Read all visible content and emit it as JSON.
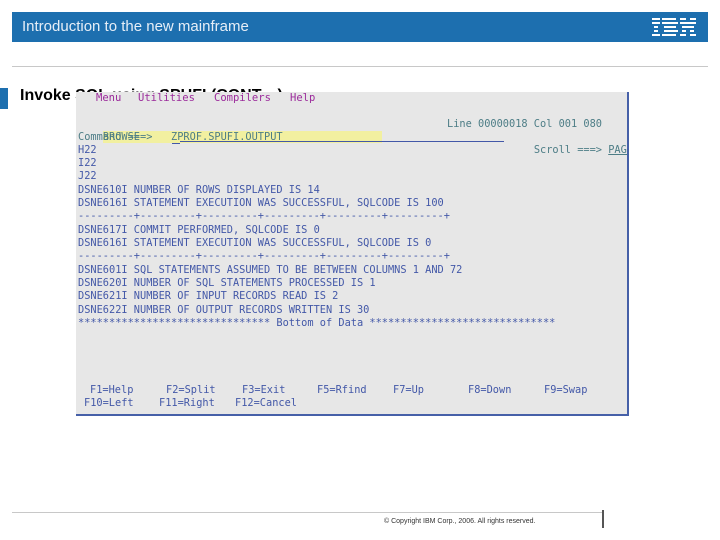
{
  "header": {
    "title": "Introduction to the new mainframe",
    "logo_text": "IBM",
    "brand_color": "#1d6faf"
  },
  "slide": {
    "title": "Invoke SQL using SPUFI (CONT…)"
  },
  "terminal": {
    "menu": [
      "Menu",
      "Utilities",
      "Compilers",
      "Help"
    ],
    "browse_label": "BROWSE",
    "dataset": "ZPROF.SPUFI.OUTPUT",
    "line_info": "Line 00000018 Col 001 080",
    "command_label": "Command ===>",
    "command_value": "",
    "scroll_label": "Scroll ===>",
    "scroll_value": "PAGE",
    "lines": [
      "H22",
      "I22",
      "J22",
      "DSNE610I NUMBER OF ROWS DISPLAYED IS 14",
      "DSNE616I STATEMENT EXECUTION WAS SUCCESSFUL, SQLCODE IS 100",
      "---------+---------+---------+---------+---------+---------+",
      "DSNE617I COMMIT PERFORMED, SQLCODE IS 0",
      "DSNE616I STATEMENT EXECUTION WAS SUCCESSFUL, SQLCODE IS 0",
      "---------+---------+---------+---------+---------+---------+",
      "DSNE601I SQL STATEMENTS ASSUMED TO BE BETWEEN COLUMNS 1 AND 72",
      "DSNE620I NUMBER OF SQL STATEMENTS PROCESSED IS 1",
      "DSNE621I NUMBER OF INPUT RECORDS READ IS 2",
      "DSNE622I NUMBER OF OUTPUT RECORDS WRITTEN IS 30",
      "******************************* Bottom of Data ******************************"
    ],
    "fkeys_row1": [
      "F1=Help",
      "F2=Split",
      "F3=Exit",
      "F5=Rfind",
      "F7=Up",
      "F8=Down",
      "F9=Swap"
    ],
    "fkeys_row2": [
      "F10=Left",
      "F11=Right",
      "F12=Cancel"
    ]
  },
  "footer": {
    "copyright": "© Copyright IBM Corp., 2006. All rights reserved."
  }
}
